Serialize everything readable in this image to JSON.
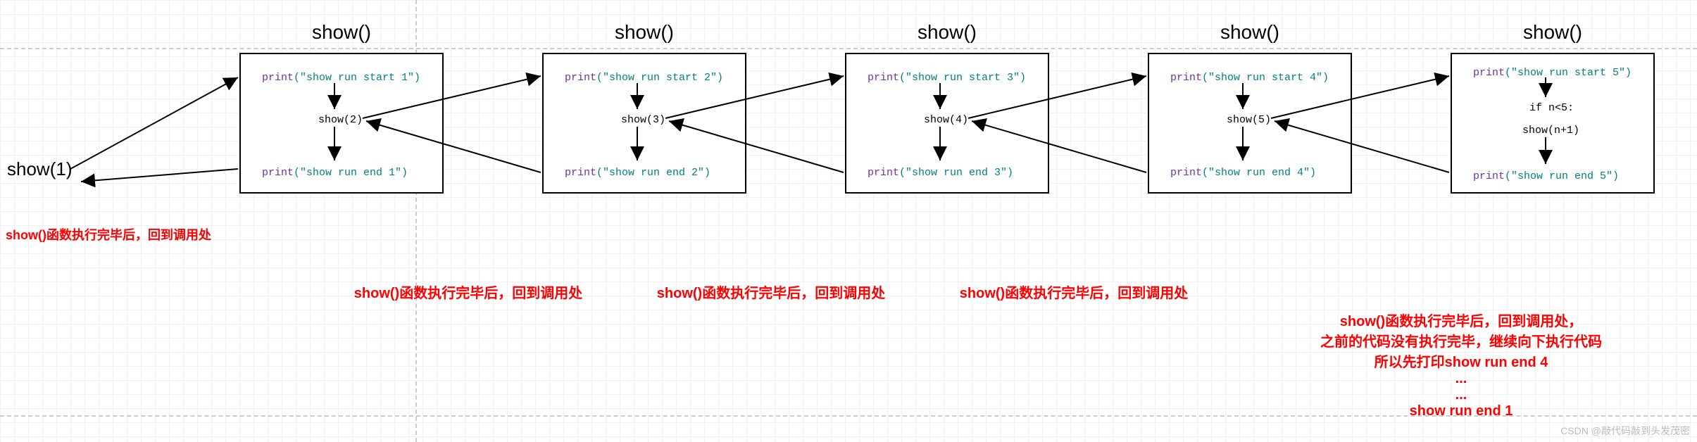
{
  "entry": "show(1)",
  "notes": {
    "left": "show()函数执行完毕后，回到调用处",
    "under_1": "show()函数执行完毕后，回到调用处",
    "under_2": "show()函数执行完毕后，回到调用处",
    "under_3": "show()函数执行完毕后，回到调用处",
    "right_line1": "show()函数执行完毕后，回到调用处，",
    "right_line2": "之前的代码没有执行完毕，继续向下执行代码",
    "right_line3": "所以先打印show run end 4",
    "right_line4": "...",
    "right_line5": "...",
    "right_line6": "show run end 1"
  },
  "titles": [
    "show()",
    "show()",
    "show()",
    "show()",
    "show()"
  ],
  "boxes": [
    {
      "start_kw": "print",
      "start_str": "(\"show run start 1\")",
      "call": "show(2)",
      "end_kw": "print",
      "end_str": "(\"show  run end 1\")"
    },
    {
      "start_kw": "print",
      "start_str": "(\"show run start 2\")",
      "call": "show(3)",
      "end_kw": "print",
      "end_str": "(\"show run end 2\")"
    },
    {
      "start_kw": "print",
      "start_str": "(\"show run start 3\")",
      "call": "show(4)",
      "end_kw": "print",
      "end_str": "(\"show run end 3\")"
    },
    {
      "start_kw": "print",
      "start_str": "(\"show run start 4\")",
      "call": "show(5)",
      "end_kw": "print",
      "end_str": "(\"show run end 4\")"
    },
    {
      "start_kw": "print",
      "start_str": "(\"show run start 5\")",
      "cond": "if n<5:",
      "recurse": "show(n+1)",
      "end_kw": "print",
      "end_str": "(\"show run end 5\")"
    }
  ],
  "watermark": "CSDN @敲代码敲到头发茂密",
  "chart_data": {
    "type": "table",
    "description": "Recursion call/return flow for function show(n)",
    "nodes": [
      {
        "id": "call",
        "label": "show(1)"
      },
      {
        "id": "f1",
        "title": "show()",
        "lines": [
          "print(\"show run start 1\")",
          "show(2)",
          "print(\"show  run end 1\")"
        ]
      },
      {
        "id": "f2",
        "title": "show()",
        "lines": [
          "print(\"show run start 2\")",
          "show(3)",
          "print(\"show run end 2\")"
        ]
      },
      {
        "id": "f3",
        "title": "show()",
        "lines": [
          "print(\"show run start 3\")",
          "show(4)",
          "print(\"show run end 3\")"
        ]
      },
      {
        "id": "f4",
        "title": "show()",
        "lines": [
          "print(\"show run start 4\")",
          "show(5)",
          "print(\"show run end 4\")"
        ]
      },
      {
        "id": "f5",
        "title": "show()",
        "lines": [
          "print(\"show run start 5\")",
          "if n<5:",
          "show(n+1)",
          "print(\"show run end 5\")"
        ]
      }
    ],
    "edges": [
      {
        "from": "call",
        "to": "f1",
        "type": "call"
      },
      {
        "from": "f1",
        "to": "f2",
        "type": "call"
      },
      {
        "from": "f2",
        "to": "f3",
        "type": "call"
      },
      {
        "from": "f3",
        "to": "f4",
        "type": "call"
      },
      {
        "from": "f4",
        "to": "f5",
        "type": "call"
      },
      {
        "from": "f5",
        "to": "f4",
        "type": "return"
      },
      {
        "from": "f4",
        "to": "f3",
        "type": "return"
      },
      {
        "from": "f3",
        "to": "f2",
        "type": "return"
      },
      {
        "from": "f2",
        "to": "f1",
        "type": "return"
      },
      {
        "from": "f1",
        "to": "call",
        "type": "return"
      }
    ],
    "internal_flow": [
      "start→call",
      "call→end (after return)",
      "start→cond→recurse→end (box 5)"
    ],
    "annotations": [
      "show()函数执行完毕后，回到调用处",
      "show()函数执行完毕后，回到调用处，之前的代码没有执行完毕，继续向下执行代码 所以先打印show run end 4 ... ... show run end 1"
    ]
  }
}
